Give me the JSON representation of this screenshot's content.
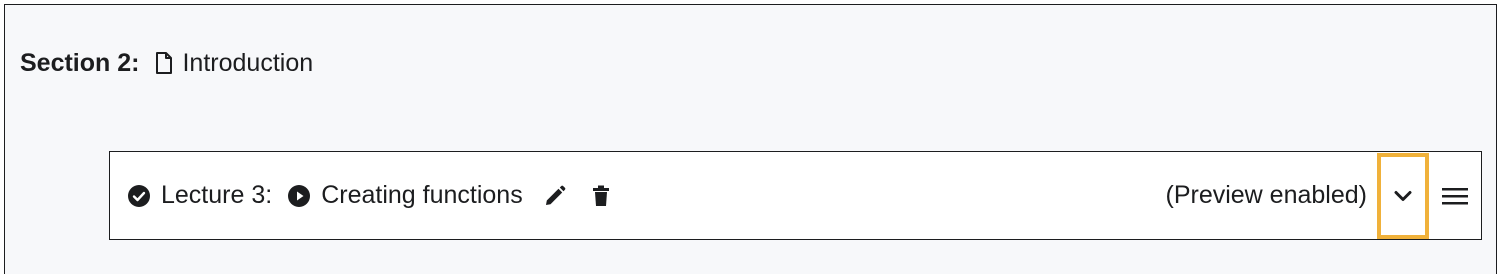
{
  "section": {
    "label": "Section 2:",
    "title": "Introduction",
    "icon": "file-icon"
  },
  "lecture": {
    "label": "Lecture 3:",
    "title": "Creating functions",
    "preview_status": "(Preview enabled)",
    "icons": [
      "check-circle-icon",
      "play-circle-icon",
      "pencil-icon",
      "trash-icon",
      "chevron-down-icon",
      "hamburger-menu-icon"
    ]
  },
  "colors": {
    "section_background": "#f7f8fa",
    "text": "#1c1d1f",
    "focus_outline": "#f0b13a"
  }
}
